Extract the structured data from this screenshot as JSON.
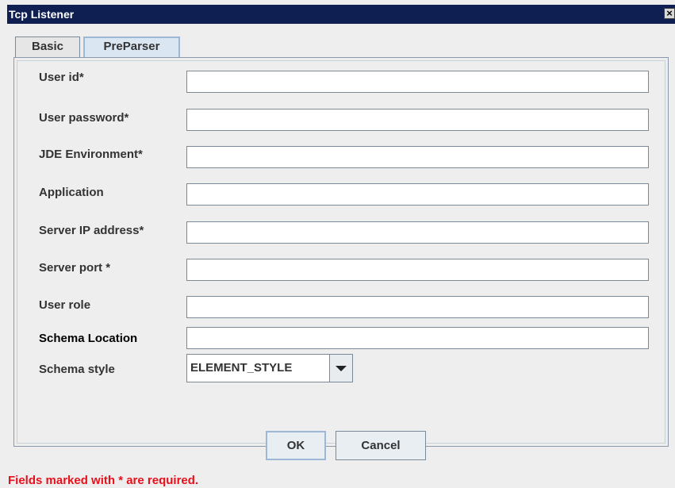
{
  "window": {
    "title": "Tcp Listener",
    "close_symbol": "×"
  },
  "tabs": [
    {
      "label": "Basic",
      "selected": false
    },
    {
      "label": "PreParser",
      "selected": true
    }
  ],
  "form": {
    "fields": [
      {
        "label": "User id*",
        "value": ""
      },
      {
        "label": "User password*",
        "value": ""
      },
      {
        "label": "JDE Environment*",
        "value": ""
      },
      {
        "label": "Application",
        "value": ""
      },
      {
        "label": "Server IP address*",
        "value": ""
      },
      {
        "label": "Server port *",
        "value": ""
      },
      {
        "label": "User role",
        "value": ""
      },
      {
        "label": "Schema Location",
        "value": ""
      }
    ],
    "schema_style": {
      "label": "Schema style",
      "selected": "ELEMENT_STYLE"
    }
  },
  "buttons": {
    "ok": "OK",
    "cancel": "Cancel"
  },
  "footer": {
    "required_note": "Fields marked with * are required.",
    "required_color": "#e8101a"
  },
  "colors": {
    "titlebar": "#0f1f52",
    "window_bg": "#eeeeee"
  }
}
